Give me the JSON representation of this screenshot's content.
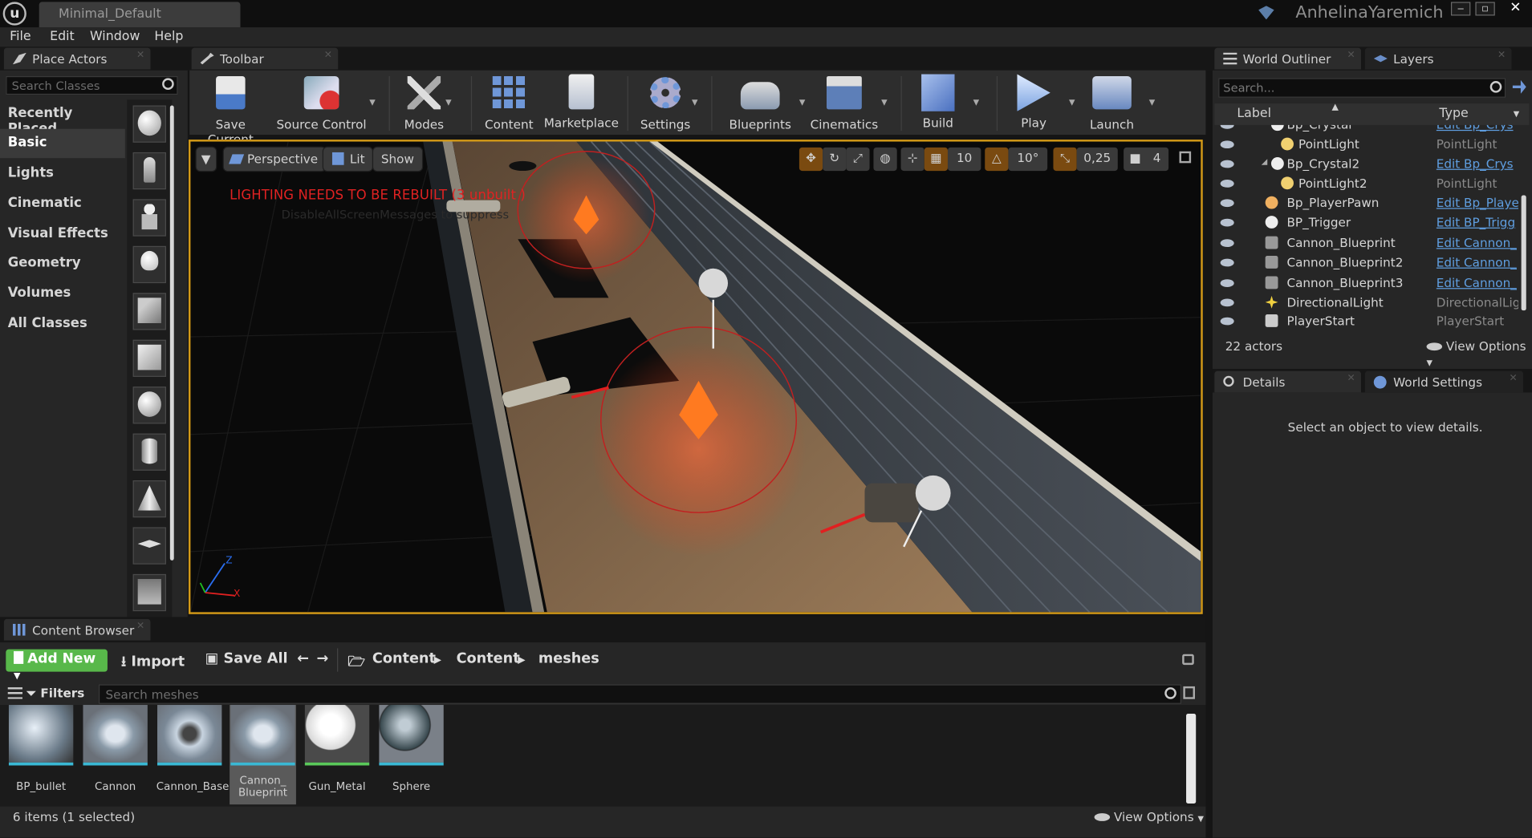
{
  "window": {
    "logo": "u",
    "project_tab": "Minimal_Default",
    "user": "AnhelinaYaremich",
    "min": "‒",
    "max": "▫",
    "close": "✕"
  },
  "menu": [
    "File",
    "Edit",
    "Window",
    "Help"
  ],
  "place_actors": {
    "tab": "Place Actors",
    "search_placeholder": "Search Classes",
    "categories": [
      "Recently Placed",
      "Basic",
      "Lights",
      "Cinematic",
      "Visual Effects",
      "Geometry",
      "Volumes",
      "All Classes"
    ],
    "selected_category": "Basic",
    "item_icons": [
      "sphere-icon",
      "character-icon",
      "pawn-icon",
      "point-light-icon",
      "player-start-icon",
      "cube-icon",
      "sphere-icon",
      "cylinder-icon",
      "cone-icon",
      "plane-icon",
      "trigger-box-icon"
    ]
  },
  "toolbar": {
    "tab": "Toolbar",
    "buttons": [
      {
        "label": "Save Current",
        "icon": "save-icon"
      },
      {
        "label": "Source Control",
        "icon": "source-control-icon"
      },
      {
        "label": "Modes",
        "icon": "modes-icon"
      },
      {
        "label": "Content",
        "icon": "content-icon"
      },
      {
        "label": "Marketplace",
        "icon": "marketplace-icon"
      },
      {
        "label": "Settings",
        "icon": "settings-icon"
      },
      {
        "label": "Blueprints",
        "icon": "blueprints-icon"
      },
      {
        "label": "Cinematics",
        "icon": "cinematics-icon"
      },
      {
        "label": "Build",
        "icon": "build-icon"
      },
      {
        "label": "Play",
        "icon": "play-icon"
      },
      {
        "label": "Launch",
        "icon": "launch-icon"
      }
    ]
  },
  "viewport": {
    "perspective": "Perspective",
    "lit": "Lit",
    "show": "Show",
    "warning": "LIGHTING NEEDS TO BE REBUILT (3 unbuilt )",
    "warning_sub": "DisableAllScreenMessages to suppress",
    "grid_snap": "10",
    "rot_snap": "10°",
    "scale_snap": "0,25",
    "cam_speed": "4",
    "axis": {
      "z": "Z",
      "x": "X"
    },
    "accent": "#d49a18"
  },
  "outliner": {
    "tabs": [
      "World Outliner",
      "Layers"
    ],
    "search_placeholder": "Search...",
    "col_label": "Label",
    "col_type": "Type",
    "rows": [
      {
        "label": "Bp_Crystal",
        "type": "Edit Bp_Crys",
        "link": true
      },
      {
        "label": "PointLight",
        "type": "PointLight",
        "link": false
      },
      {
        "label": "Bp_Crystal2",
        "type": "Edit Bp_Crys",
        "link": true
      },
      {
        "label": "PointLight2",
        "type": "PointLight",
        "link": false
      },
      {
        "label": "Bp_PlayerPawn",
        "type": "Edit Bp_Playe",
        "link": true
      },
      {
        "label": "BP_Trigger",
        "type": "Edit BP_Trigg",
        "link": true
      },
      {
        "label": "Cannon_Blueprint",
        "type": "Edit Cannon_",
        "link": true
      },
      {
        "label": "Cannon_Blueprint2",
        "type": "Edit Cannon_",
        "link": true
      },
      {
        "label": "Cannon_Blueprint3",
        "type": "Edit Cannon_",
        "link": true
      },
      {
        "label": "DirectionalLight",
        "type": "DirectionalLigh",
        "link": false
      },
      {
        "label": "PlayerStart",
        "type": "PlayerStart",
        "link": false
      }
    ],
    "count": "22 actors",
    "view_options": "View Options"
  },
  "details": {
    "tabs": [
      "Details",
      "World Settings"
    ],
    "empty_msg": "Select an object to view details."
  },
  "content_browser": {
    "tab": "Content Browser",
    "add_new": "Add New",
    "import": "Import",
    "save_all": "Save All",
    "path": [
      "Content",
      "Content",
      "meshes"
    ],
    "filters": "Filters",
    "search_placeholder": "Search meshes",
    "assets": [
      {
        "name": "BP_bullet",
        "kind": "sphere",
        "selected": false
      },
      {
        "name": "Cannon",
        "kind": "cannon",
        "selected": false
      },
      {
        "name": "Cannon_Base",
        "kind": "base",
        "selected": false
      },
      {
        "name": "Cannon_ Blueprint",
        "kind": "cannon",
        "selected": true
      },
      {
        "name": "Gun_Metal",
        "kind": "white",
        "selected": false
      },
      {
        "name": "Sphere",
        "kind": "dark",
        "selected": false
      }
    ],
    "count": "6 items (1 selected)",
    "view_options": "View Options"
  }
}
